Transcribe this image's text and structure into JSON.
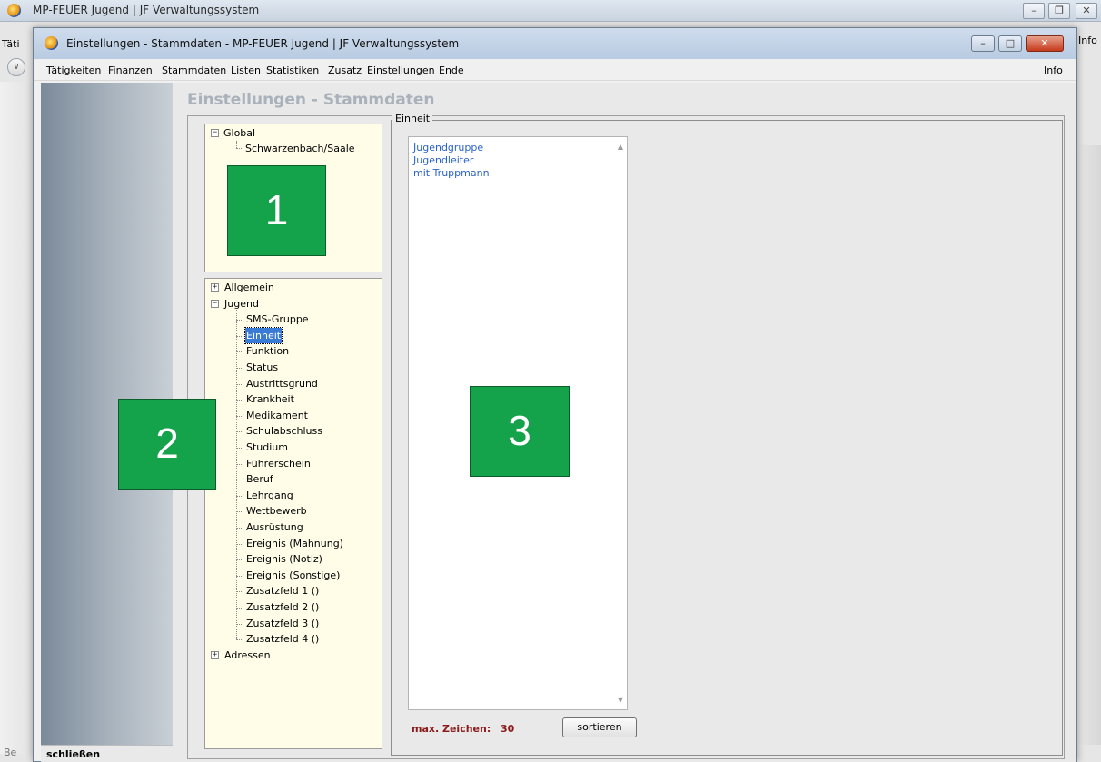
{
  "background_window": {
    "title": "MP-FEUER Jugend | JF Verwaltungssystem",
    "menu_fragment": "Täti",
    "info_fragment": "Info",
    "bottom_fragment": "Be"
  },
  "dialog": {
    "title": "Einstellungen - Stammdaten - MP-FEUER Jugend | JF Verwaltungssystem",
    "menu": [
      "Tätigkeiten",
      "Finanzen",
      "Stammdaten",
      "Listen",
      "Statistiken",
      "Zusatz",
      "Einstellungen",
      "Ende"
    ],
    "menu_info": "Info",
    "page_heading": "Einstellungen - Stammdaten",
    "close_label": "schließen"
  },
  "tree_global": {
    "root": "Global",
    "children": [
      "Schwarzenbach/Saale"
    ]
  },
  "tree_categories": {
    "allgemein": "Allgemein",
    "jugend": "Jugend",
    "jugend_children": [
      "SMS-Gruppe",
      "Einheit",
      "Funktion",
      "Status",
      "Austrittsgrund",
      "Krankheit",
      "Medikament",
      "Schulabschluss",
      "Studium",
      "Führerschein",
      "Beruf",
      "Lehrgang",
      "Wettbewerb",
      "Ausrüstung",
      "Ereignis (Mahnung)",
      "Ereignis (Notiz)",
      "Ereignis (Sonstige)",
      "Zusatzfeld 1 ()",
      "Zusatzfeld 2 ()",
      "Zusatzfeld 3 ()",
      "Zusatzfeld 4 ()"
    ],
    "selected": "Einheit",
    "adressen": "Adressen"
  },
  "einheit": {
    "group_label": "Einheit",
    "entries": [
      "Jugendgruppe",
      "Jugendleiter",
      "mit Truppmann"
    ],
    "max_chars_label": "max. Zeichen:",
    "max_chars_value": "30",
    "sort_label": "sortieren"
  },
  "markers": [
    "1",
    "2",
    "3"
  ],
  "colors": {
    "marker_green": "#14a24a",
    "tree_background": "#fffde8",
    "selection_blue": "#3a7bd5",
    "list_text_blue": "#2a63c8",
    "max_chars_red": "#8b1a1a"
  }
}
